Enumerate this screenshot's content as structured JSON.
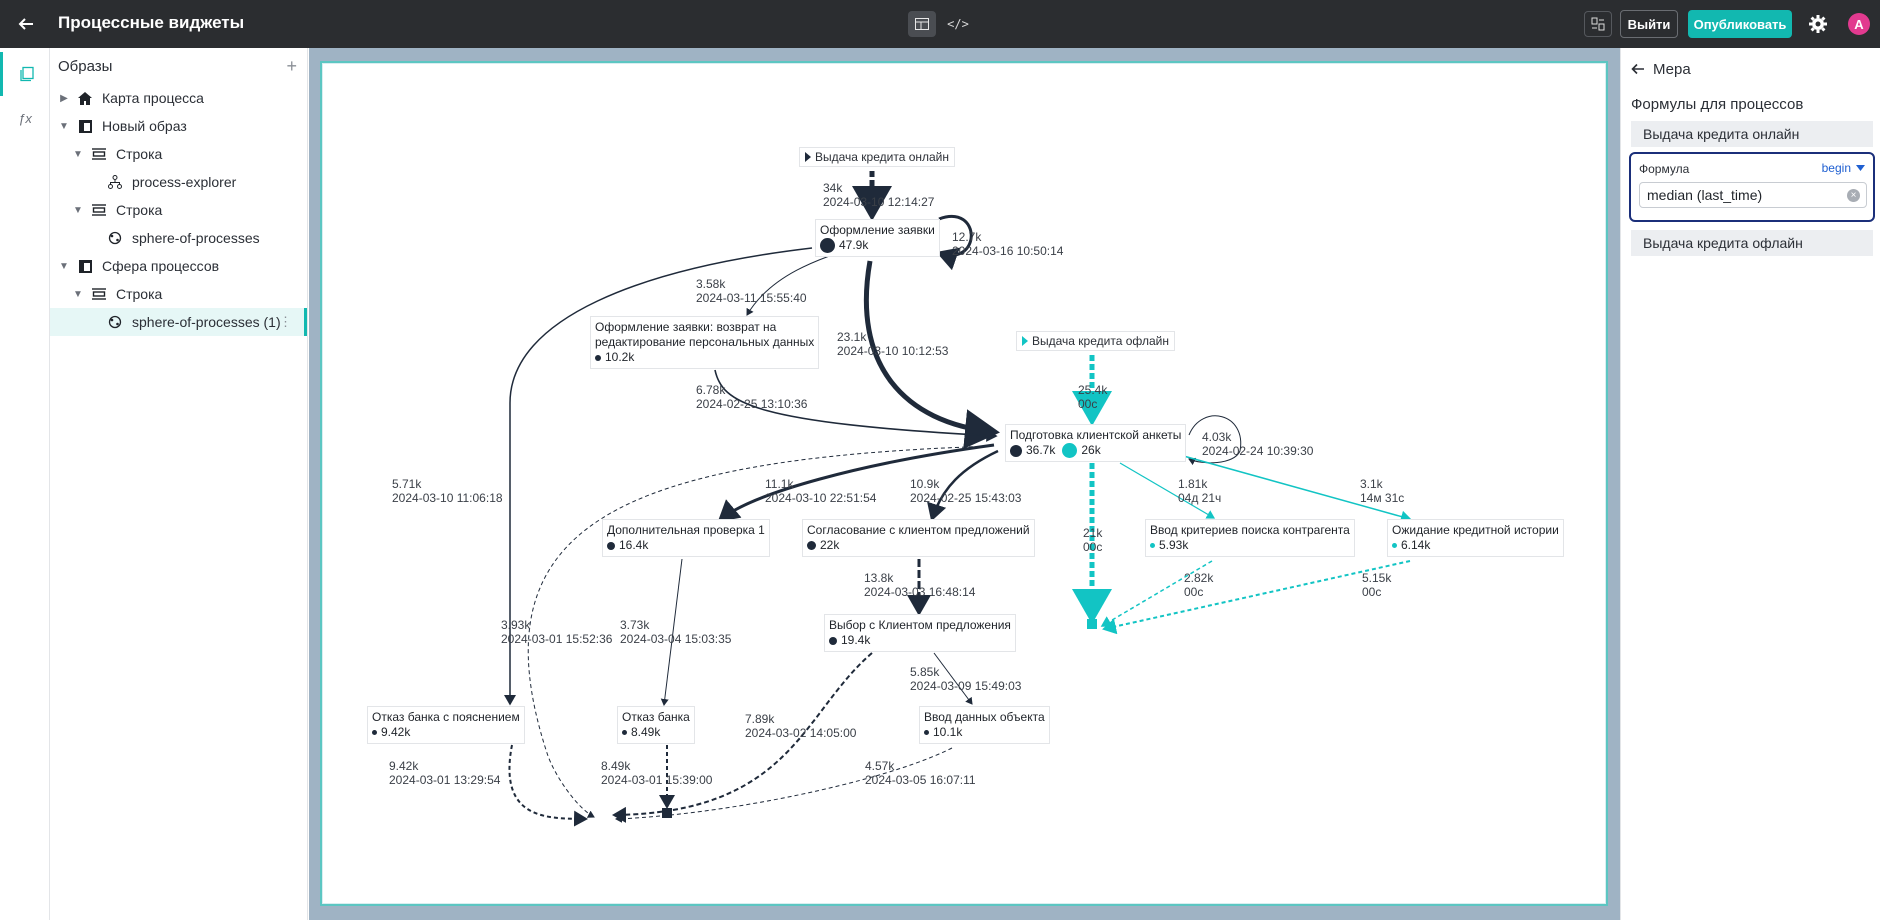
{
  "header": {
    "title": "Процессные виджеты",
    "code_toggle": "</>",
    "exit_label": "Выйти",
    "publish_label": "Опубликовать",
    "avatar_letter": "A",
    "accent_color": "#12b8b0"
  },
  "rail": {
    "items": [
      "pages-icon",
      "formula-icon"
    ],
    "formula_glyph": "ƒx"
  },
  "tree": {
    "title": "Образы",
    "add": "+",
    "items": [
      {
        "label": "Карта процесса"
      },
      {
        "label": "Новый образ"
      },
      {
        "label": "Строка"
      },
      {
        "label": "process-explorer"
      },
      {
        "label": "Строка"
      },
      {
        "label": "sphere-of-processes"
      },
      {
        "label": "Сфера процессов"
      },
      {
        "label": "Строка"
      },
      {
        "label": "sphere-of-processes (1)"
      }
    ]
  },
  "graph": {
    "start1": "Выдача кредита онлайн",
    "start2": "Выдача кредита офлайн",
    "nodes": {
      "n1": {
        "label": "Оформление заявки",
        "count": "47.9k"
      },
      "n2": {
        "label1": "Оформление заявки: возврат на",
        "label2": "редактирование персональных данных",
        "count": "10.2k"
      },
      "n3": {
        "label": "Подготовка клиентской анкеты",
        "count": "36.7k",
        "count2": "26k"
      },
      "n4": {
        "label": "Дополнительная проверка 1",
        "count": "16.4k"
      },
      "n5": {
        "label": "Согласование с клиентом предложений",
        "count": "22k"
      },
      "n6": {
        "label": "Ввод критериев поиска контрагента",
        "count": "5.93k"
      },
      "n7": {
        "label": "Ожидание кредитной истории",
        "count": "6.14k"
      },
      "n8": {
        "label": "Выбор с Клиентом предложения",
        "count": "19.4k"
      },
      "n9": {
        "label": "Отказ банка с пояснением",
        "count": "9.42k"
      },
      "n10": {
        "label": "Отказ банка",
        "count": "8.49k"
      },
      "n11": {
        "label": "Ввод данных объекта",
        "count": "10.1k"
      }
    },
    "edges": {
      "e1": {
        "a": "34k",
        "b": "2024-03-10 12:14:27"
      },
      "e2": {
        "a": "12.7k",
        "b": "2024-03-16 10:50:14"
      },
      "e3": {
        "a": "3.58k",
        "b": "2024-03-11 15:55:40"
      },
      "e4": {
        "a": "23.1k",
        "b": "2024-03-10 10:12:53"
      },
      "e5": {
        "a": "25.4k",
        "b": "00с"
      },
      "e6": {
        "a": "6.78k",
        "b": "2024-02-25 13:10:36"
      },
      "e7": {
        "a": "4.03k",
        "b": "2024-02-24 10:39:30"
      },
      "e8": {
        "a": "5.71k",
        "b": "2024-03-10 11:06:18"
      },
      "e9": {
        "a": "11.1k",
        "b": "2024-03-10 22:51:54"
      },
      "e10": {
        "a": "10.9k",
        "b": "2024-02-25 15:43:03"
      },
      "e11": {
        "a": "1.81k",
        "b": "04д 21ч"
      },
      "e12": {
        "a": "3.1k",
        "b": "14м 31с"
      },
      "e13": {
        "a": "21k",
        "b": "00с"
      },
      "e14": {
        "a": "13.8k",
        "b": "2024-03-03 16:48:14"
      },
      "e15": {
        "a": "2.82k",
        "b": "00с"
      },
      "e16": {
        "a": "5.15k",
        "b": "00с"
      },
      "e17": {
        "a": "3.93k",
        "b": "2024-03-01 15:52:36"
      },
      "e18": {
        "a": "3.73k",
        "b": "2024-03-04 15:03:35"
      },
      "e19": {
        "a": "5.85k",
        "b": "2024-03-09 15:49:03"
      },
      "e20": {
        "a": "7.89k",
        "b": "2024-03-02 14:05:00"
      },
      "e21": {
        "a": "9.42k",
        "b": "2024-03-01 13:29:54"
      },
      "e22": {
        "a": "8.49k",
        "b": "2024-03-01 15:39:00"
      },
      "e23": {
        "a": "4.57k",
        "b": "2024-03-05 16:07:11"
      }
    },
    "colors": {
      "dark": "#1f2a3a",
      "teal": "#12c4c4"
    }
  },
  "rpanel": {
    "title": "Мера",
    "subtitle": "Формулы для процессов",
    "item1": "Выдача кредита онлайн",
    "formula_label": "Формула",
    "formula_select": "begin",
    "formula_value": "median (last_time)",
    "item2": "Выдача кредита офлайн"
  }
}
